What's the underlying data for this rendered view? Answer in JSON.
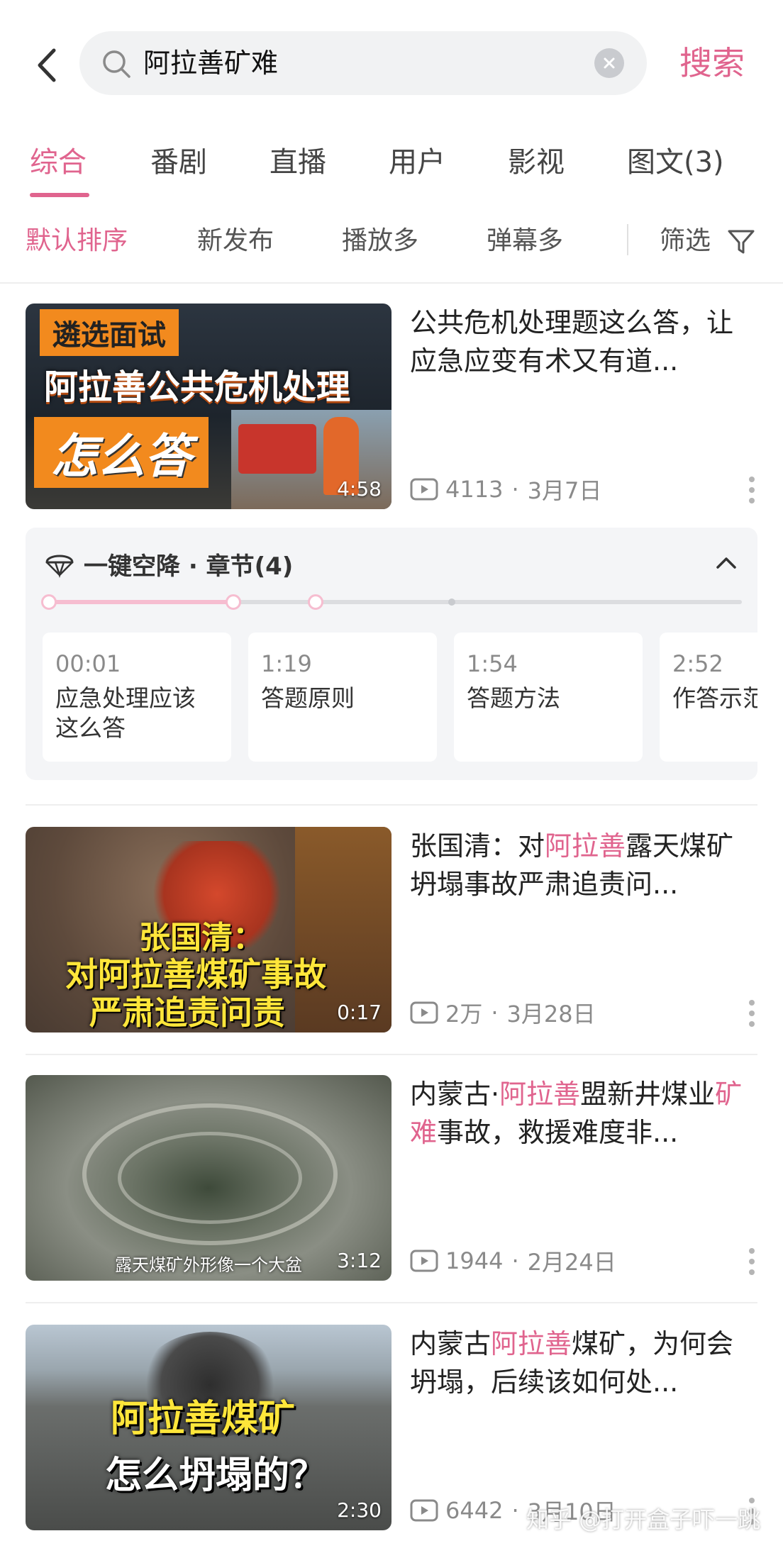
{
  "search": {
    "query": "阿拉善矿难",
    "submit_label": "搜索"
  },
  "tabs": [
    {
      "label": "综合",
      "active": true
    },
    {
      "label": "番剧",
      "active": false
    },
    {
      "label": "直播",
      "active": false
    },
    {
      "label": "用户",
      "active": false
    },
    {
      "label": "影视",
      "active": false
    },
    {
      "label": "图文(3)",
      "active": false
    }
  ],
  "sort": {
    "options": [
      "默认排序",
      "新发布",
      "播放多",
      "弹幕多"
    ],
    "active": "默认排序",
    "filter_label": "筛选"
  },
  "colors": {
    "accent": "#e0648e",
    "muted": "#8a8a8a"
  },
  "results": [
    {
      "title_parts": [
        {
          "text": "公共危机处理题这么答，让应急应变有术又有道...",
          "hl": false
        }
      ],
      "views": "4113",
      "date": "3月7日",
      "duration": "4:58",
      "thumb_captions": [
        "遴选面试",
        "阿拉善公共危机处理",
        "怎么答"
      ]
    },
    {
      "title_parts": [
        {
          "text": "张国清：对",
          "hl": false
        },
        {
          "text": "阿拉善",
          "hl": true
        },
        {
          "text": "露天煤矿坍塌事故严肃追责问...",
          "hl": false
        }
      ],
      "views": "2万",
      "date": "3月28日",
      "duration": "0:17",
      "thumb_captions": [
        "张国清：",
        "对阿拉善煤矿事故",
        "严肃追责问责"
      ]
    },
    {
      "title_parts": [
        {
          "text": "内蒙古·",
          "hl": false
        },
        {
          "text": "阿拉善",
          "hl": true
        },
        {
          "text": "盟新井煤业",
          "hl": false
        },
        {
          "text": "矿难",
          "hl": true
        },
        {
          "text": "事故，救援难度非...",
          "hl": false
        }
      ],
      "views": "1944",
      "date": "2月24日",
      "duration": "3:12",
      "thumb_captions": [
        "露天煤矿外形像一个大盆"
      ]
    },
    {
      "title_parts": [
        {
          "text": "内蒙古",
          "hl": false
        },
        {
          "text": "阿拉善",
          "hl": true
        },
        {
          "text": "煤矿，为何会坍塌，后续该如何处...",
          "hl": false
        }
      ],
      "views": "6442",
      "date": "3月10日",
      "duration": "2:30",
      "thumb_captions": [
        "阿拉善煤矿",
        "怎么坍塌的？"
      ]
    }
  ],
  "chapters": {
    "header": "一键空降 · 章节(4)",
    "items": [
      {
        "time": "00:01",
        "title": "应急处理应该这么答"
      },
      {
        "time": "1:19",
        "title": "答题原则"
      },
      {
        "time": "1:54",
        "title": "答题方法"
      },
      {
        "time": "2:52",
        "title": "作答示范"
      }
    ]
  },
  "watermark": "知乎 @打开盒子吓一跳"
}
